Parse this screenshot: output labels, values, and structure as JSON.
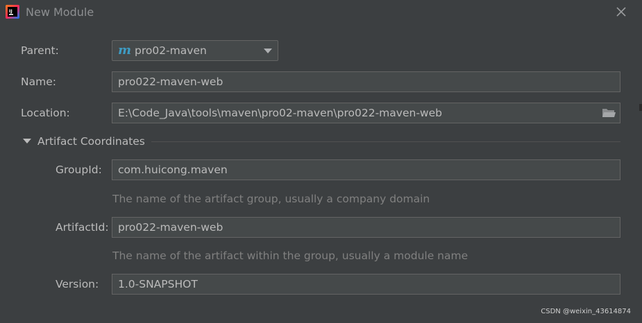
{
  "window": {
    "title": "New Module",
    "app_icon": "intellij-idea-icon",
    "close_icon": "close-icon"
  },
  "form": {
    "parent": {
      "label": "Parent:",
      "value": "pro02-maven",
      "icon": "maven-module-icon"
    },
    "name": {
      "label": "Name:",
      "value": "pro022-maven-web"
    },
    "location": {
      "label": "Location:",
      "value": "E:\\Code_Java\\tools\\maven\\pro02-maven\\pro022-maven-web",
      "icon": "folder-icon"
    }
  },
  "artifact": {
    "section_title": "Artifact Coordinates",
    "expanded": true,
    "group_id": {
      "label": "GroupId:",
      "value": "com.huicong.maven",
      "hint": "The name of the artifact group, usually a company domain"
    },
    "artifact_id": {
      "label": "ArtifactId:",
      "value": "pro022-maven-web",
      "hint": "The name of the artifact within the group, usually a module name"
    },
    "version": {
      "label": "Version:",
      "value": "1.0-SNAPSHOT"
    }
  },
  "watermark": "CSDN @weixin_43614874",
  "colors": {
    "background": "#3c3f41",
    "field_background": "#45494a",
    "field_border": "#646464",
    "text": "#bbbbbb",
    "hint_text": "#808080",
    "maven_accent": "#3e9cc4"
  }
}
